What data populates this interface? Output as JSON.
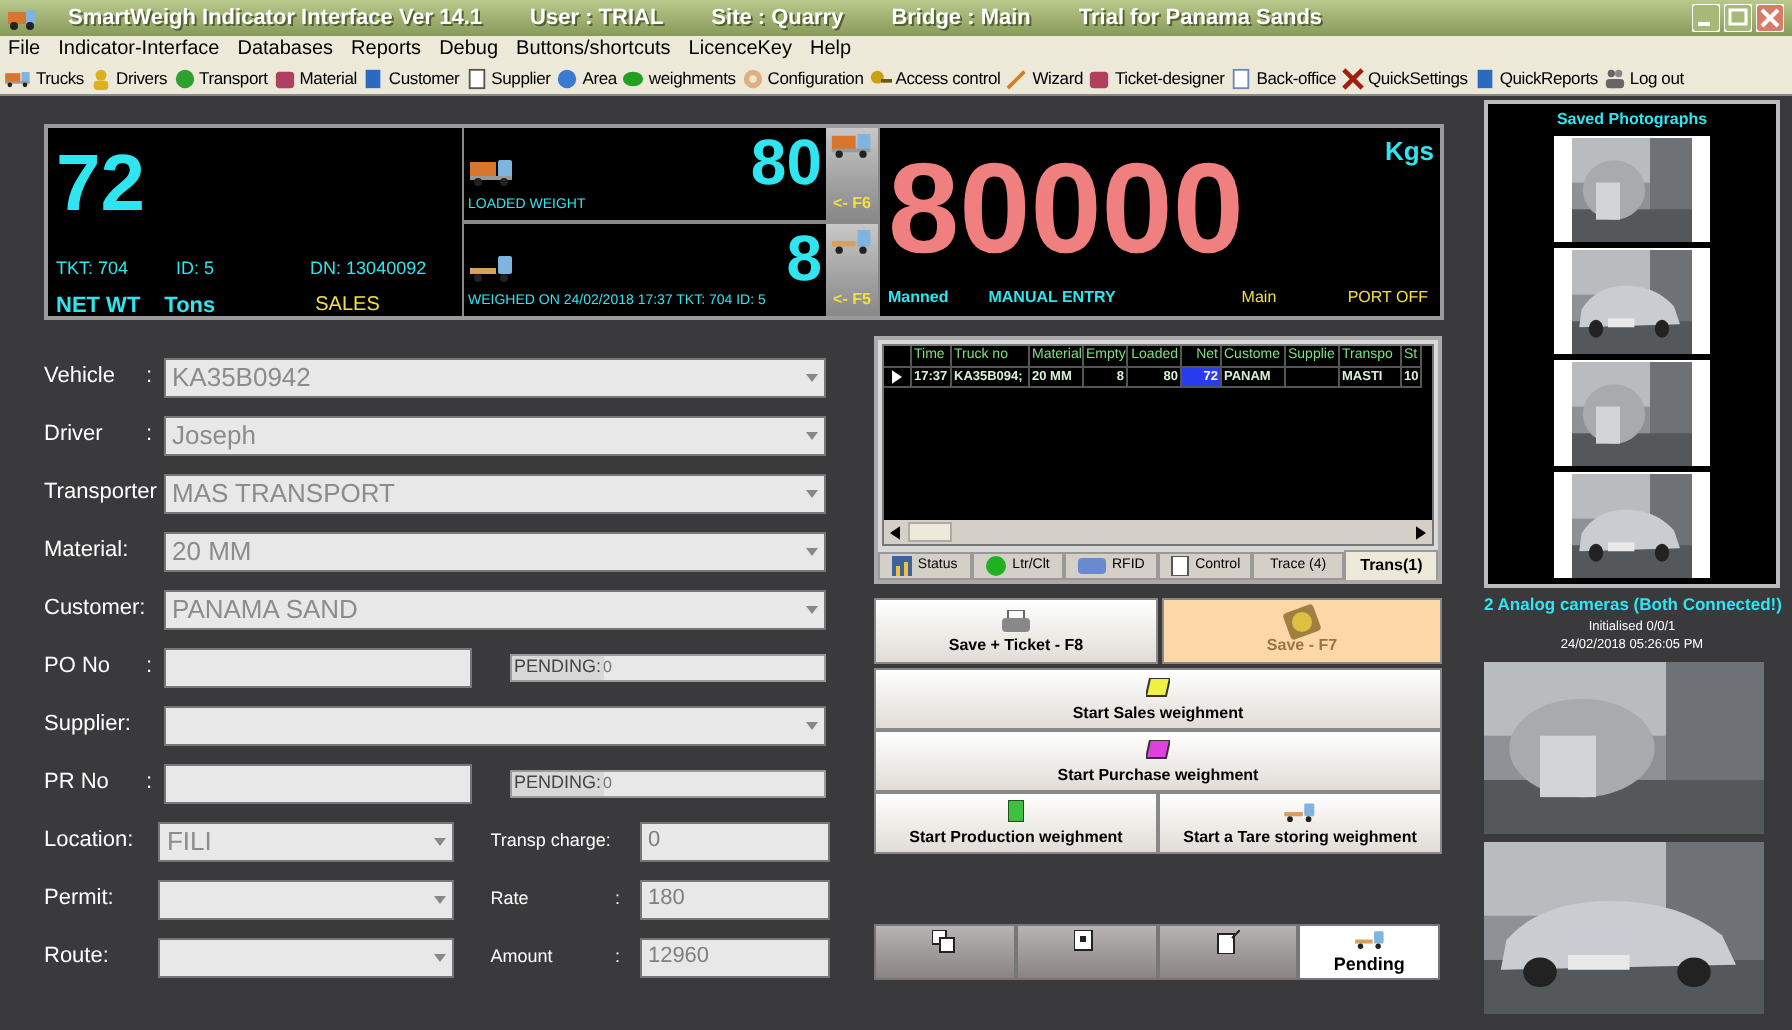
{
  "window": {
    "title_segments": [
      "SmartWeigh Indicator Interface Ver 14.1",
      "User :  TRIAL",
      "Site :  Quarry",
      "Bridge :  Main",
      "Trial for Panama Sands"
    ]
  },
  "menu": [
    "File",
    "Indicator-Interface",
    "Databases",
    "Reports",
    "Debug",
    "Buttons/shortcuts",
    "LicenceKey",
    "Help"
  ],
  "toolbar": [
    "Trucks",
    "Drivers",
    "Transport",
    "Material",
    "Customer",
    "Supplier",
    "Area",
    "weighments",
    "Configuration",
    "Access control",
    "Wizard",
    "Ticket-designer",
    "Back-office",
    "QuickSettings",
    "QuickReports",
    "Log out"
  ],
  "display": {
    "net": "72",
    "ticket": "TKT: 704",
    "id": "ID: 5",
    "dn": "DN: 13040092",
    "net_label": "NET WT",
    "unit_label": "Tons",
    "mode": "SALES",
    "loaded": {
      "value": "80",
      "label": "LOADED WEIGHT",
      "key": "<- F6"
    },
    "empty": {
      "value": "8",
      "label": "WEIGHED ON 24/02/2018 17:37  TKT: 704 ID: 5",
      "key": "<- F5"
    },
    "reading": "80000",
    "reading_unit": "Kgs",
    "status": "Manned",
    "entry": "MANUAL ENTRY",
    "bridge": "Main",
    "port": "PORT OFF"
  },
  "form": {
    "rows": [
      {
        "label": "Vehicle",
        "colon": ":",
        "kind": "dropdown",
        "value": "KA35B0942"
      },
      {
        "label": "Driver",
        "colon": ":",
        "kind": "dropdown",
        "value": "Joseph"
      },
      {
        "label": "Transporter",
        "kind": "dropdown",
        "value": "MAS TRANSPORT"
      },
      {
        "label": "Material:",
        "kind": "dropdown",
        "value": "20 MM"
      },
      {
        "label": "Customer:",
        "kind": "dropdown",
        "value": "PANAMA SAND"
      },
      {
        "label": "PO No",
        "colon": ":",
        "kind": "text",
        "extra": {
          "kind": "pending",
          "label": "PENDING:",
          "value": "0"
        }
      },
      {
        "label": "Supplier:",
        "kind": "dropdown"
      },
      {
        "label": "PR No",
        "colon": ":",
        "kind": "text",
        "extra": {
          "kind": "pending",
          "label": "PENDING:",
          "value": "0"
        }
      },
      {
        "label": "Location:",
        "kind": "short-dropdown",
        "value": "FILI",
        "extra": {
          "kind": "labeled",
          "label": "Transp charge:",
          "value": "0"
        }
      },
      {
        "label": "Permit:",
        "kind": "short-dropdown",
        "extra": {
          "kind": "labeled",
          "label": "Rate",
          "colon": ":",
          "value": "180"
        }
      },
      {
        "label": "Route:",
        "kind": "short-dropdown",
        "extra": {
          "kind": "labeled",
          "label": "Amount",
          "colon": ":",
          "value": "12960"
        }
      }
    ]
  },
  "grid": {
    "columns": [
      "Time",
      "Truck no",
      "Material",
      "Empty",
      "Loaded",
      "Net",
      "Custome",
      "Supplie",
      "Transpo",
      "St"
    ],
    "rows": [
      {
        "current": true,
        "cells": [
          {
            "text": "17:37",
            "selected": false
          },
          {
            "text": "KA35B094;",
            "selected": false
          },
          {
            "text": "20 MM",
            "selected": false
          },
          {
            "text": "8",
            "selected": false
          },
          {
            "text": "80",
            "selected": false
          },
          {
            "text": "72",
            "selected": true
          },
          {
            "text": "PANAM",
            "selected": false
          },
          {
            "text": null,
            "selected": false
          },
          {
            "text": "MASTI",
            "selected": false
          },
          {
            "text": "10",
            "selected": false
          }
        ]
      }
    ]
  },
  "tabs": [
    {
      "label": "Status",
      "selected": false
    },
    {
      "label": "Ltr/Clt",
      "selected": false
    },
    {
      "label": "RFID",
      "selected": false
    },
    {
      "label": "Control",
      "selected": false
    },
    {
      "label": "Trace (4)",
      "selected": false
    },
    {
      "label": "Trans(1)",
      "selected": true
    }
  ],
  "actions": [
    {
      "label": "Save + Ticket - F8",
      "disabled": false
    },
    {
      "label": "Save - F7",
      "disabled": true
    }
  ],
  "weighments": [
    "Start Sales weighment",
    "Start Purchase weighment",
    "Start Production weighment",
    "Start a Tare storing weighment"
  ],
  "bottom_buttons": [
    {
      "selected": false
    },
    {
      "selected": false
    },
    {
      "selected": false
    },
    {
      "label": "Pending",
      "selected": true
    }
  ],
  "photos": {
    "title": "Saved Photographs"
  },
  "cameras": {
    "status": "2 Analog cameras (Both Connected!)",
    "init": "Initialised 0/0/1",
    "time": "24/02/2018 05:26:05 PM"
  }
}
